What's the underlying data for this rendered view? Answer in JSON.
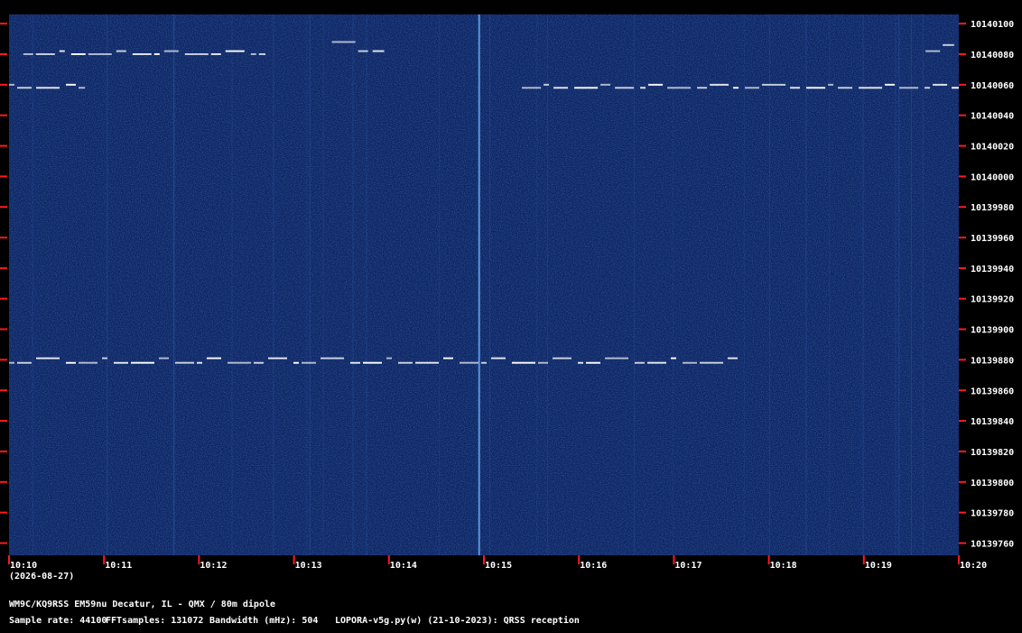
{
  "chart_data": {
    "type": "heatmap",
    "title": "",
    "xlabel": "",
    "ylabel": "",
    "x_ticks": [
      "10:10",
      "10:11",
      "10:12",
      "10:13",
      "10:14",
      "10:15",
      "10:16",
      "10:17",
      "10:18",
      "10:19",
      "10:20"
    ],
    "date_label": "(2026-08-27)",
    "y_ticks": [
      "10140100",
      "10140080",
      "10140060",
      "10140040",
      "10140020",
      "10140000",
      "10139980",
      "10139960",
      "10139940",
      "10139920",
      "10139900",
      "10139880",
      "10139860",
      "10139840",
      "10139820",
      "10139800",
      "10139780",
      "10139760"
    ],
    "xlim_minutes": [
      0,
      10
    ],
    "ylim": [
      10139752,
      10140106
    ],
    "background_color": "#0d2563",
    "tick_color": "#ff1a1a",
    "signal_color": "#ffffff",
    "signals": [
      {
        "segments": [
          [
            0.0,
            0.8
          ]
        ],
        "center": 10140058,
        "shift": 2,
        "style": "fsk"
      },
      {
        "segments": [
          [
            5.4,
            10.0
          ]
        ],
        "center": 10140058,
        "shift": 2,
        "style": "fsk"
      },
      {
        "segments": [
          [
            0.15,
            2.7
          ]
        ],
        "center": 10140080,
        "shift": 2,
        "style": "fsk"
      },
      {
        "segments": [
          [
            3.4,
            3.95
          ]
        ],
        "center": 10140082,
        "shift": 6,
        "style": "fsk"
      },
      {
        "segments": [
          [
            9.65,
            9.95
          ]
        ],
        "center": 10140082,
        "shift": 4,
        "style": "fsk"
      },
      {
        "segments": [
          [
            0.0,
            7.7
          ]
        ],
        "center": 10139878,
        "shift": 3,
        "style": "fsk"
      }
    ],
    "spikes": [
      4.95
    ]
  },
  "footer": {
    "station": "WM9C/KQ9RSS EM59nu Decatur, IL - QMX / 80m dipole",
    "sample_rate": "Sample rate: 44100",
    "fft_samples": "FFTsamples: 131072",
    "bandwidth": "Bandwidth (mHz): 504",
    "software": "LOPORA-v5g.py(w) (21-10-2023): QRSS reception"
  }
}
